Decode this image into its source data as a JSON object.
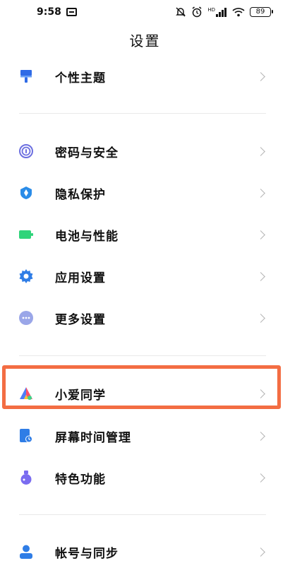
{
  "status_bar": {
    "time": "9:58",
    "network": "HD",
    "battery": "89"
  },
  "title": "设置",
  "sections": [
    {
      "items": [
        {
          "id": "theme",
          "label": "个性主题",
          "icon": "brush-icon",
          "color": "#2f6be6"
        }
      ]
    },
    {
      "items": [
        {
          "id": "password",
          "label": "密码与安全",
          "icon": "fingerprint-icon",
          "color": "#6c6fe0"
        },
        {
          "id": "privacy",
          "label": "隐私保护",
          "icon": "shield-icon",
          "color": "#2a8ce8"
        },
        {
          "id": "battery",
          "label": "电池与性能",
          "icon": "battery-icon",
          "color": "#2fd47a"
        },
        {
          "id": "apps",
          "label": "应用设置",
          "icon": "gear-icon",
          "color": "#2f7de6"
        },
        {
          "id": "more",
          "label": "更多设置",
          "icon": "more-icon",
          "color": "#9aa6e8"
        }
      ]
    },
    {
      "items": [
        {
          "id": "xiaoai",
          "label": "小爱同学",
          "icon": "xiaoai-icon",
          "color": "#ff4f6a"
        },
        {
          "id": "screentime",
          "label": "屏幕时间管理",
          "icon": "screen-time-icon",
          "color": "#2f7de6"
        },
        {
          "id": "features",
          "label": "特色功能",
          "icon": "flask-icon",
          "color": "#7a6cf0"
        }
      ]
    },
    {
      "items": [
        {
          "id": "account",
          "label": "帐号与同步",
          "icon": "user-icon",
          "color": "#2f7de6"
        }
      ]
    }
  ],
  "highlight": {
    "color": "#f36d43",
    "target": "小爱同学"
  }
}
